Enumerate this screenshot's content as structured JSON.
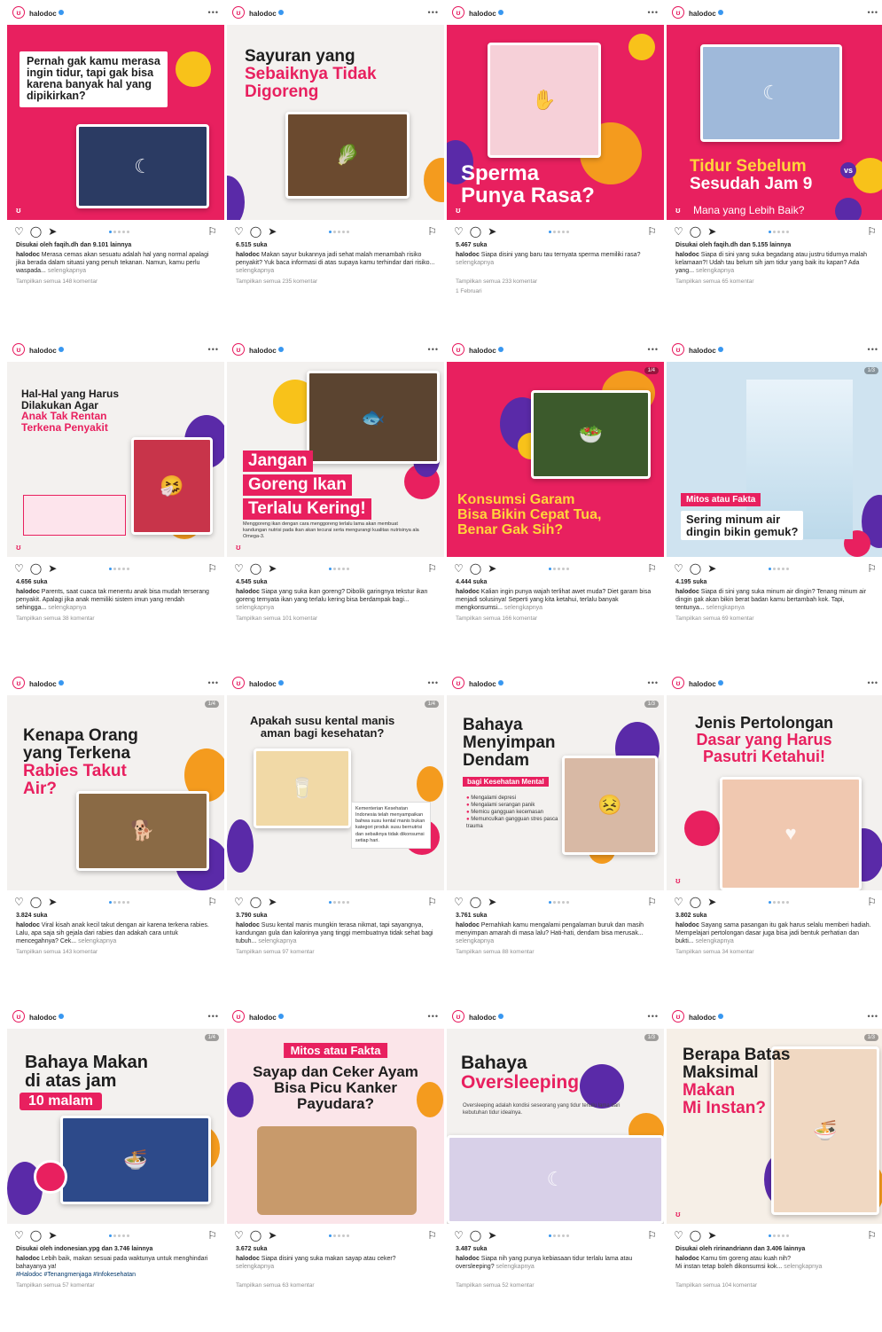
{
  "colors": {
    "brand_pink": "#e8205f",
    "brand_purple": "#5a2aa8",
    "brand_orange": "#f49b1e",
    "link_blue": "#3897f0"
  },
  "icons": {
    "like": "heart-icon",
    "comment": "comment-icon",
    "share": "share-icon",
    "save": "bookmark-icon",
    "more": "more-dots-icon"
  },
  "posts": [
    {
      "username": "halodoc",
      "headline": [
        "Pernah gak kamu merasa",
        "ingin tidur, tapi gak bisa",
        "karena banyak hal yang",
        "dipikirkan?"
      ],
      "likes": "Disukai oleh faqih.dh dan 9.101 lainnya",
      "caption": "Merasa cemas akan sesuatu adalah hal yang normal apalagi jika berada dalam situasi yang penuh tekanan. Namun, kamu perlu waspada...",
      "more": "selengkapnya",
      "comments": "Tampilkan semua 148 komentar"
    },
    {
      "username": "halodoc",
      "headline": [
        "Sayuran yang",
        "Sebaiknya Tidak",
        "Digoreng"
      ],
      "likes": "6.515 suka",
      "caption": "Makan sayur bukannya jadi sehat malah menambah risiko penyakit? Yuk baca informasi di atas supaya kamu terhindar dari risiko...",
      "more": "selengkapnya",
      "comments": "Tampilkan semua 235 komentar"
    },
    {
      "username": "halodoc",
      "headline": [
        "Sperma",
        "Punya Rasa?"
      ],
      "likes": "5.467 suka",
      "caption": "Siapa disini yang baru tau ternyata sperma memiliki rasa?",
      "more": "selengkapnya",
      "comments": "Tampilkan semua 233 komentar",
      "date": "1 Februari"
    },
    {
      "username": "halodoc",
      "headline": [
        "Tidur Sebelum",
        "Sesudah Jam 9"
      ],
      "vs": "vs",
      "sub": "Mana yang Lebih Baik?",
      "likes": "Disukai oleh faqih.dh dan 5.155 lainnya",
      "caption": "Siapa di sini yang suka begadang atau justru tidurnya malah kelamaan?! Udah tau belum sih jam tidur yang baik itu kapan? Ada yang...",
      "more": "selengkapnya",
      "comments": "Tampilkan semua 65 komentar"
    },
    {
      "username": "halodoc",
      "headline": [
        "Hal-Hal yang Harus",
        "Dilakukan Agar",
        "Anak Tak Rentan",
        "Terkena Penyakit"
      ],
      "likes": "4.656 suka",
      "caption": "Parents, saat cuaca tak menentu anak bisa mudah terserang penyakit. Apalagi jika anak memiliki sistem imun yang rendah sehingga...",
      "more": "selengkapnya",
      "comments": "Tampilkan semua 38 komentar"
    },
    {
      "username": "halodoc",
      "headline": [
        "Jangan",
        "Goreng Ikan",
        "Terlalu Kering!"
      ],
      "sub": "Menggoreng ikan dengan cara menggoreng terlalu lama akan membuat kandungan nutrisi pada ikan akan tecurai serta mengurangi kualitas nutrisinya ala Omega-3.",
      "likes": "4.545 suka",
      "caption": "Siapa yang suka ikan goreng? Dibolik garingnya tekstur ikan goreng ternyata ikan yang terlalu kering bisa berdampak bagi...",
      "more": "selengkapnya",
      "comments": "Tampilkan semua 101 komentar"
    },
    {
      "username": "halodoc",
      "headline": [
        "Konsumsi Garam",
        "Bisa Bikin Cepat Tua,",
        "Benar Gak Sih?"
      ],
      "counter": "1/4",
      "likes": "4.444 suka",
      "caption": "Kalian ingin punya wajah terlihat awet muda? Diet garam bisa menjadi solusinya! Seperti yang kita ketahui, terlalu banyak mengkonsumsi...",
      "more": "selengkapnya",
      "comments": "Tampilkan semua 166 komentar"
    },
    {
      "username": "halodoc",
      "tag": "Mitos atau Fakta",
      "headline": [
        "Sering minum air",
        "dingin bikin gemuk?"
      ],
      "counter": "1/3",
      "likes": "4.195 suka",
      "caption": "Siapa di sini yang suka minum air dingin? Tenang minum air dingin gak akan bikin berat badan kamu bertambah kok. Tapi, tentunya...",
      "more": "selengkapnya",
      "comments": "Tampilkan semua 69 komentar"
    },
    {
      "username": "halodoc",
      "headline": [
        "Kenapa Orang",
        "yang Terkena",
        "Rabies Takut",
        "Air?"
      ],
      "counter": "1/4",
      "likes": "3.824 suka",
      "caption": "Viral kisah anak kecil takut dengan air karena terkena rabies. Lalu, apa saja sih gejala dari rabies dan adakah cara untuk mencegahnya? Cek...",
      "more": "selengkapnya",
      "comments": "Tampilkan semua 143 komentar"
    },
    {
      "username": "halodoc",
      "headline": [
        "Apakah susu kental manis",
        "aman bagi kesehatan?"
      ],
      "counter": "1/4",
      "note": "Kementerian Kesehatan Indonesia telah menyampaikan bahwa susu kental manis bukan kategori produk susu bernutrisi dan sebaiknya tidak dikonsumsi setiap hari.",
      "likes": "3.790 suka",
      "caption": "Susu kental manis mungkin terasa nikmat, tapi sayangnya, kandungan gula dan kalorinya yang tinggi membuatnya tidak sehat bagi tubuh...",
      "more": "selengkapnya",
      "comments": "Tampilkan semua 97 komentar"
    },
    {
      "username": "halodoc",
      "headline": [
        "Bahaya",
        "Menyimpan",
        "Dendam"
      ],
      "sub": "bagi Kesehatan Mental",
      "counter": "1/3",
      "bullets": [
        "Mengalami depresi",
        "Mengalami serangan panik",
        "Memicu gangguan kecemasan",
        "Memunculkan gangguan stres pasca trauma"
      ],
      "likes": "3.761 suka",
      "caption": "Pernahkah kamu mengalami pengalaman buruk dan masih menyimpan amarah di masa lalu? Hati-hati, dendam bisa merusak...",
      "more": "selengkapnya",
      "comments": "Tampilkan semua 88 komentar"
    },
    {
      "username": "halodoc",
      "headline": [
        "Jenis Pertolongan",
        "Dasar yang Harus",
        "Pasutri Ketahui!"
      ],
      "likes": "3.802 suka",
      "caption": "Sayang sama pasangan itu gak harus selalu memberi hadiah. Mempelajari pertolongan dasar juga bisa jadi bentuk perhatian dan bukti...",
      "more": "selengkapnya",
      "comments": "Tampilkan semua 34 komentar"
    },
    {
      "username": "halodoc",
      "headline": [
        "Bahaya Makan",
        "di atas jam"
      ],
      "highlight": "10 malam",
      "counter": "1/4",
      "likes": "Disukai oleh indonesian.ypg dan 3.746 lainnya",
      "caption": "Lebih baik, makan sesuai pada waktunya untuk menghindari bahayanya ya!",
      "hashtags": "#Halodoc #Tenangmenjaga #Infokesehatan",
      "more": "",
      "comments": "Tampilkan semua 57 komentar"
    },
    {
      "username": "halodoc",
      "tag": "Mitos atau Fakta",
      "headline": [
        "Sayap dan Ceker Ayam",
        "Bisa Picu Kanker",
        "Payudara?"
      ],
      "likes": "3.672 suka",
      "caption": "Siapa disini yang suka makan sayap atau ceker?",
      "more": "selengkapnya",
      "comments": "Tampilkan semua 63 komentar"
    },
    {
      "username": "halodoc",
      "headline": [
        "Bahaya",
        "Oversleeping"
      ],
      "counter": "1/3",
      "sub": "Oversleeping adalah kondisi seseorang yang tidur terlalu lama dari kebutuhan tidur idealnya.",
      "likes": "3.487 suka",
      "caption": "Siapa nih yang punya kebiasaan tidur terlalu lama atau oversleeping?",
      "more": "selengkapnya",
      "comments": "Tampilkan semua 52 komentar"
    },
    {
      "username": "halodoc",
      "headline": [
        "Berapa Batas",
        "Maksimal",
        "Makan",
        "Mi Instan?"
      ],
      "counter": "1/3",
      "likes": "Disukai oleh ririnandriann dan 3.406 lainnya",
      "caption": "Kamu tim goreng atau kuah nih?",
      "caption2": "Mi instan tetap boleh dikonsumsi kok...",
      "more": "selengkapnya",
      "comments": "Tampilkan semua 104 komentar"
    }
  ]
}
